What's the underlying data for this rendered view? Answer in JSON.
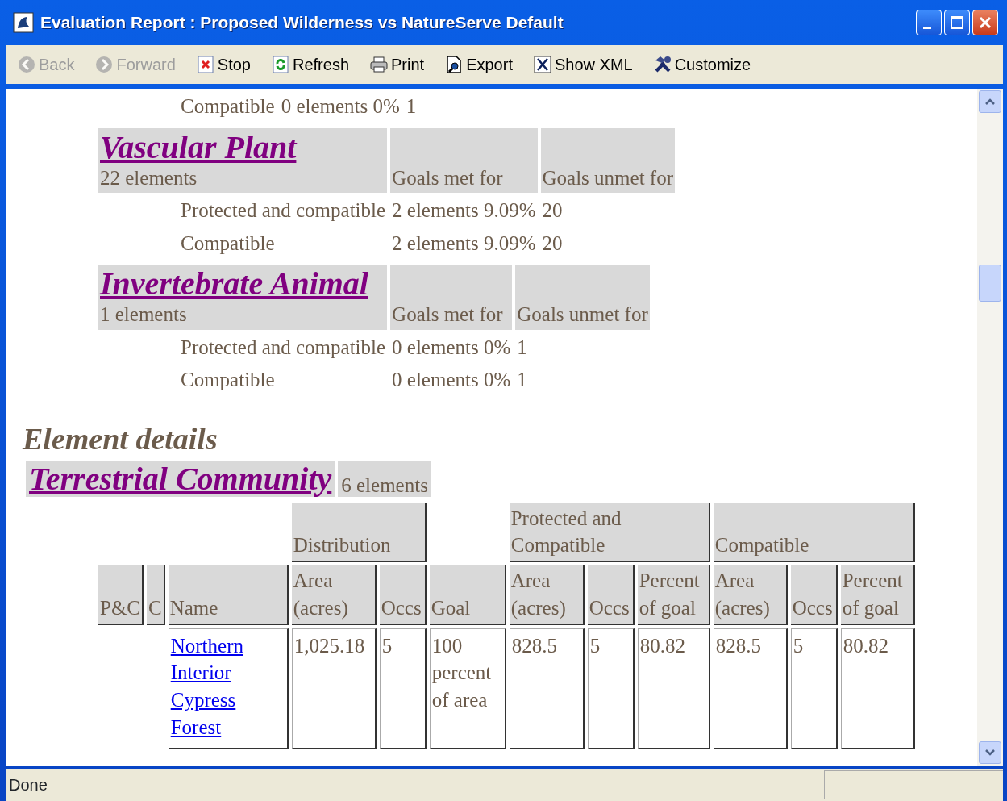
{
  "window": {
    "title": "Evaluation Report : Proposed Wilderness vs NatureServe Default"
  },
  "toolbar": [
    {
      "kind": "back",
      "label": "Back",
      "disabled": true
    },
    {
      "kind": "forward",
      "label": "Forward",
      "disabled": true
    },
    {
      "kind": "stop",
      "label": "Stop",
      "disabled": false
    },
    {
      "kind": "refresh",
      "label": "Refresh",
      "disabled": false
    },
    {
      "kind": "print",
      "label": "Print",
      "disabled": false
    },
    {
      "kind": "export",
      "label": "Export",
      "disabled": false
    },
    {
      "kind": "xml",
      "label": "Show XML",
      "disabled": false
    },
    {
      "kind": "customize",
      "label": "Customize",
      "disabled": false
    }
  ],
  "summary": {
    "leading_rows": [
      {
        "label": "Compatible",
        "met": "0 elements 0%",
        "unmet": "1"
      }
    ],
    "groups": [
      {
        "title": "Vascular Plant",
        "count": "22 elements",
        "met_header": "Goals met for",
        "unmet_header": "Goals unmet for",
        "rows": [
          {
            "label": "Protected and compatible",
            "met": "2 elements 9.09%",
            "unmet": "20"
          },
          {
            "label": "Compatible",
            "met": "2 elements 9.09%",
            "unmet": "20"
          }
        ]
      },
      {
        "title": "Invertebrate Animal",
        "count": "1 elements",
        "met_header": "Goals met for",
        "unmet_header": "Goals unmet for",
        "rows": [
          {
            "label": "Protected and compatible",
            "met": "0 elements 0%",
            "unmet": "1"
          },
          {
            "label": "Compatible",
            "met": "0 elements 0%",
            "unmet": "1"
          }
        ]
      }
    ]
  },
  "details": {
    "heading": "Element details",
    "category": {
      "title": "Terrestrial Community",
      "count": "6 elements"
    },
    "column_groups": [
      {
        "columns": [
          "P&C",
          "C",
          "Name"
        ]
      },
      {
        "label": "Distribution",
        "columns": [
          "Area (acres)",
          "Occs"
        ]
      },
      {
        "columns": [
          "Goal"
        ]
      },
      {
        "label": "Protected and Compatible",
        "columns": [
          "Area (acres)",
          "Occs",
          "Percent of goal"
        ]
      },
      {
        "label": "Compatible",
        "columns": [
          "Area (acres)",
          "Occs",
          "Percent of goal"
        ]
      }
    ],
    "rows": [
      {
        "name": "Northern Interior Cypress Forest",
        "values": [
          "1,025.18",
          "5",
          "100 percent of area",
          "828.5",
          "5",
          "80.82",
          "828.5",
          "5",
          "80.82"
        ]
      }
    ]
  },
  "status_bar": {
    "text": "Done"
  }
}
